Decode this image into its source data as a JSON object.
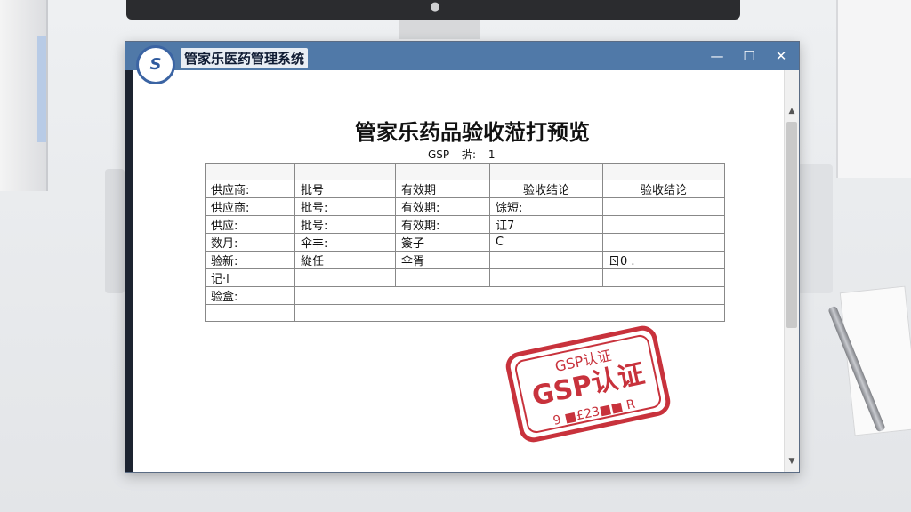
{
  "window": {
    "app_title": "管家乐医药管理系统",
    "logo_text": "S",
    "min_label": "—",
    "max_label": "☐",
    "close_label": "✕"
  },
  "document": {
    "title": "管家乐药品验收蒞打预览",
    "gsp_label": "GSP",
    "gsp_mid": "扸:",
    "gsp_value": "1"
  },
  "table": {
    "header": [
      "",
      "",
      "",
      "",
      ""
    ],
    "rows": [
      [
        "供应商:",
        "批号",
        "有效期",
        "验收结论",
        "验收结论"
      ],
      [
        "供应商:",
        "批号:",
        "有效期:",
        "馀短:",
        ""
      ],
      [
        "供应:",
        "批号:",
        "有效期:",
        "讧7",
        ""
      ],
      [
        "数月:",
        "伞丰:",
        "簽子",
        "C",
        ""
      ],
      [
        "验新:",
        "緃任",
        "伞胥",
        "",
        "ㄖ0  ."
      ],
      [
        "记·l",
        "",
        "",
        "",
        ""
      ],
      [
        "验盒:",
        "",
        "",
        "",
        ""
      ],
      [
        "",
        "",
        "",
        "",
        ""
      ]
    ]
  },
  "stamp": {
    "top_text": "GSP认证",
    "main_text": "GSP认证",
    "bottom_text": "9 ■£23■■ R",
    "color": "#c8323c"
  },
  "colors": {
    "titlebar": "#5079a8",
    "accent": "#3b64a3"
  }
}
